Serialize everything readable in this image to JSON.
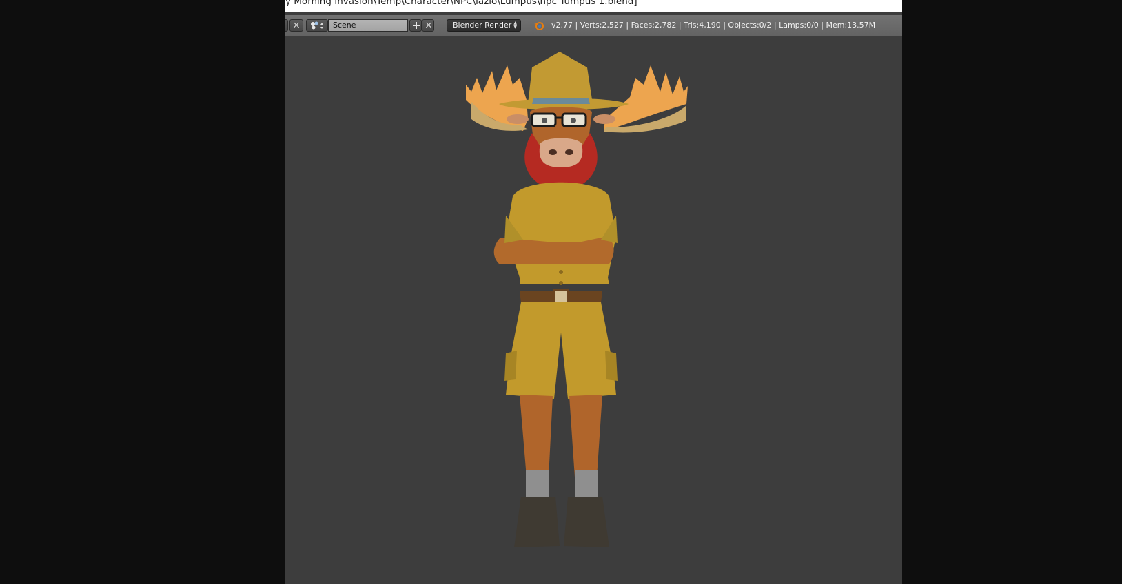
{
  "window": {
    "title": "y Morning Invasion\\Temp\\Character\\NPC\\lazlo\\Lumpus\\npc_lumpus 1.blend]"
  },
  "header": {
    "scene_name": "Scene",
    "render_engine": "Blender Render",
    "stats": "v2.77 | Verts:2,527 | Faces:2,782 | Tris:4,190 | Objects:0/2 | Lamps:0/0 | Mem:13.57M"
  },
  "icons": [
    "close-icon",
    "scene-browse-icon",
    "add-icon",
    "blender-logo-icon"
  ],
  "colors": {
    "viewport_bg": "#3d3d3d",
    "header_bg": "#6a6a6a",
    "character_shirt": "#c29a2c",
    "antlers": "#eba24c",
    "scarf": "#b52a22"
  }
}
